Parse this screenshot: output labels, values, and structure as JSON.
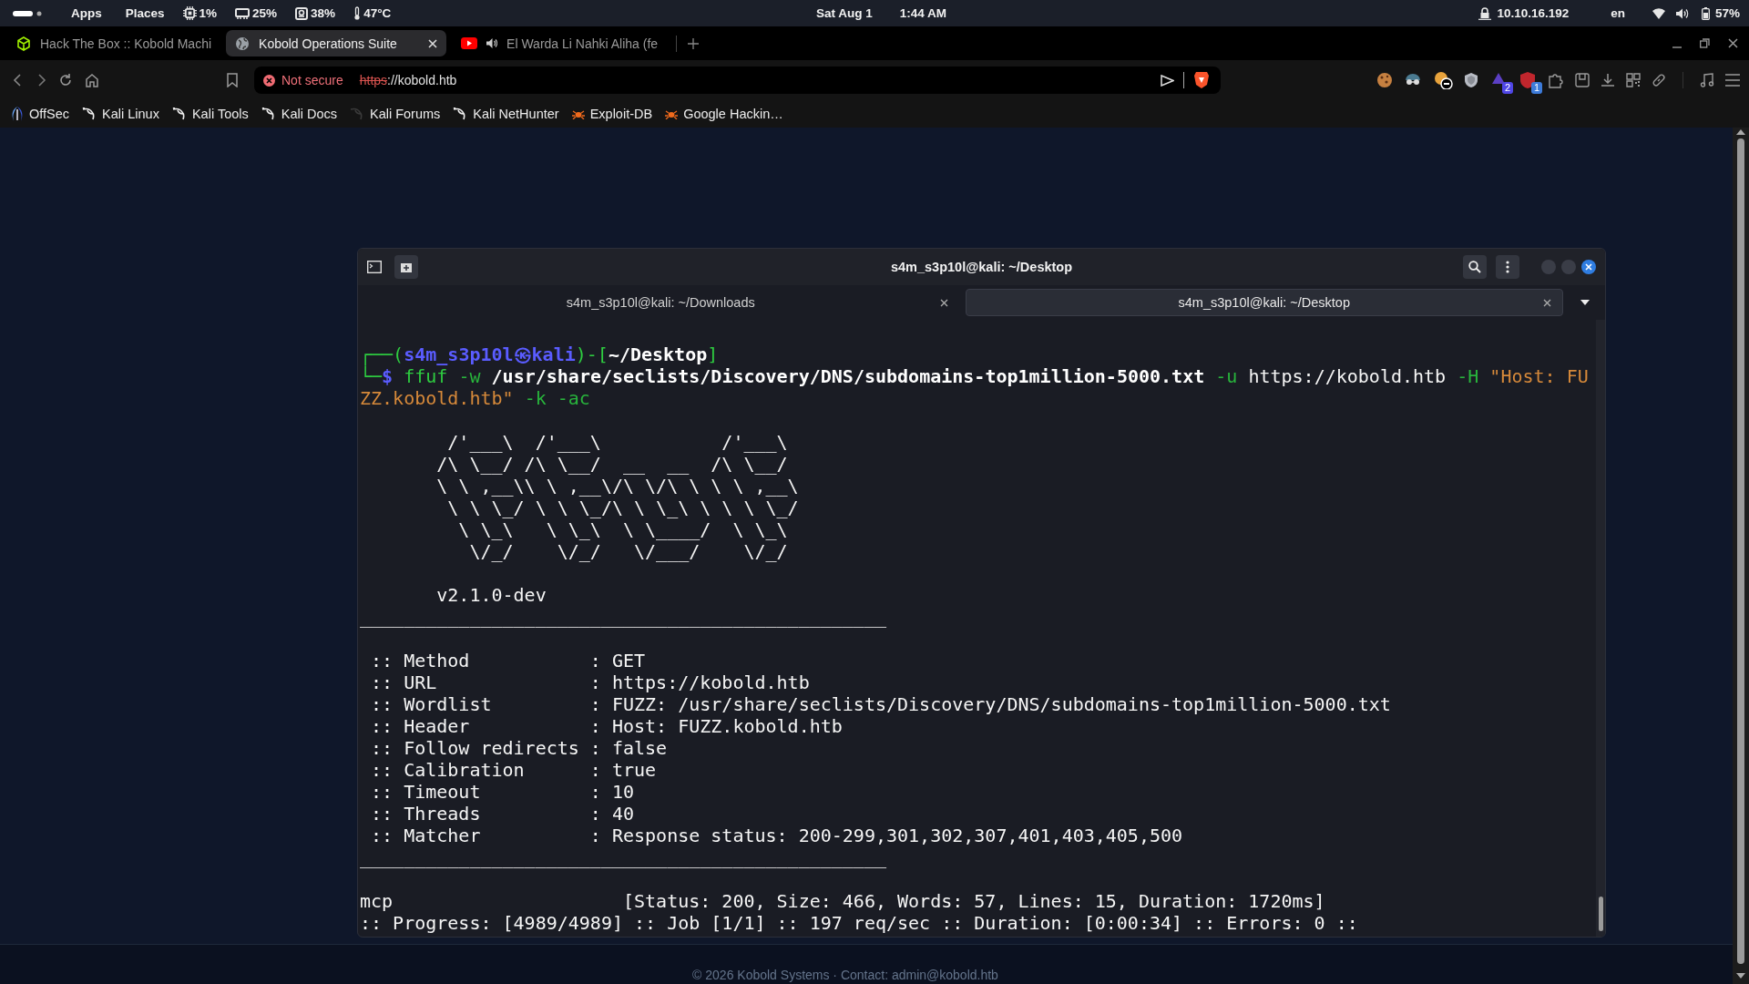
{
  "system_bar": {
    "menus": [
      "Apps",
      "Places"
    ],
    "stats": [
      {
        "kind": "cpu",
        "text": "1%"
      },
      {
        "kind": "memory",
        "text": "25%"
      },
      {
        "kind": "disk",
        "text": "38%"
      },
      {
        "kind": "temperature",
        "text": "47°C"
      }
    ],
    "date": "Sat Aug 1",
    "time": "1:44 AM",
    "vpn_ip": "10.10.16.192",
    "keyboard": "en",
    "battery": "57%"
  },
  "browser": {
    "tabs": [
      {
        "title": "Hack The Box :: Kobold Machi",
        "kind": "htb",
        "selected": false,
        "audio": false
      },
      {
        "title": "Kobold Operations Suite",
        "kind": "globe",
        "selected": true,
        "audio": false
      },
      {
        "title": "El Warda Li Nahki Aliha (fe",
        "kind": "youtube",
        "selected": false,
        "audio": true
      }
    ],
    "address": {
      "security": "Not secure",
      "scheme": "https",
      "rest": "://kobold.htb"
    },
    "extension_badges": [
      "2",
      "1"
    ],
    "bookmarks": [
      {
        "label": "OffSec",
        "kind": "offsec"
      },
      {
        "label": "Kali Linux",
        "kind": "kali"
      },
      {
        "label": "Kali Tools",
        "kind": "kali"
      },
      {
        "label": "Kali Docs",
        "kind": "kali"
      },
      {
        "label": "Kali Forums",
        "kind": "kali-dark"
      },
      {
        "label": "Kali NetHunter",
        "kind": "kali"
      },
      {
        "label": "Exploit-DB",
        "kind": "bug"
      },
      {
        "label": "Google Hackin…",
        "kind": "bug"
      }
    ]
  },
  "terminal": {
    "title": "s4m_s3p10l@kali: ~/Desktop",
    "tabs": [
      {
        "label": "s4m_s3p10l@kali: ~/Downloads",
        "selected": false
      },
      {
        "label": "s4m_s3p10l@kali: ~/Desktop",
        "selected": true
      }
    ],
    "prompt": {
      "open": "┌──(",
      "user": "s4m_s3p10l",
      "at": "㉿",
      "host": "kali",
      "mid": ")-[",
      "directory": "~/Desktop",
      "close": "]",
      "corner": "└─",
      "sign": "$"
    },
    "command": [
      {
        "kind": "program",
        "text": "ffuf"
      },
      {
        "kind": "flag",
        "text": "-w"
      },
      {
        "kind": "path",
        "text": "/usr/share/seclists/Discovery/DNS/subdomains-top1million-5000.txt"
      },
      {
        "kind": "flag",
        "text": "-u"
      },
      {
        "kind": "plain",
        "text": "https://kobold.htb"
      },
      {
        "kind": "flag",
        "text": "-H"
      },
      {
        "kind": "string",
        "text": "\"Host: FUZZ.kobold.htb\""
      },
      {
        "kind": "flag",
        "text": "-k"
      },
      {
        "kind": "flag",
        "text": "-ac"
      }
    ],
    "output": [
      {
        "kind": "banner",
        "lines": [
          "        /'___\\  /'___\\           /'___\\",
          "       /\\ \\__/ /\\ \\__/  __  __  /\\ \\__/",
          "       \\ \\ ,__\\\\ \\ ,__\\/\\ \\/\\ \\ \\ \\ ,__\\",
          "        \\ \\ \\_/ \\ \\ \\_/\\ \\ \\_\\ \\ \\ \\ \\_/",
          "         \\ \\_\\   \\ \\_\\  \\ \\____/  \\ \\_\\",
          "          \\/_/    \\/_/   \\/___/    \\/_/"
        ]
      },
      {
        "kind": "version",
        "text": "       v2.1.0-dev"
      },
      {
        "kind": "rule",
        "text": "________________________________________________"
      },
      {
        "kind": "setting",
        "text": " :: Method           : GET"
      },
      {
        "kind": "setting",
        "text": " :: URL              : https://kobold.htb"
      },
      {
        "kind": "setting",
        "text": " :: Wordlist         : FUZZ: /usr/share/seclists/Discovery/DNS/subdomains-top1million-5000.txt"
      },
      {
        "kind": "setting",
        "text": " :: Header           : Host: FUZZ.kobold.htb"
      },
      {
        "kind": "setting",
        "text": " :: Follow redirects : false"
      },
      {
        "kind": "setting",
        "text": " :: Calibration      : true"
      },
      {
        "kind": "setting",
        "text": " :: Timeout          : 10"
      },
      {
        "kind": "setting",
        "text": " :: Threads          : 40"
      },
      {
        "kind": "setting",
        "text": " :: Matcher          : Response status: 200-299,301,302,307,401,403,405,500"
      },
      {
        "kind": "rule",
        "text": "________________________________________________"
      },
      {
        "kind": "result",
        "word": "mcp",
        "details": "[Status: 200, Size: 466, Words: 57, Lines: 15, Duration: 1720ms]"
      },
      {
        "kind": "progress",
        "text": ":: Progress: [4989/4989] :: Job [1/1] :: 197 req/sec :: Duration: [0:00:34] :: Errors: 0 ::"
      }
    ]
  },
  "footer": {
    "text": "© 2026 Kobold Systems · Contact: admin@kobold.htb"
  }
}
